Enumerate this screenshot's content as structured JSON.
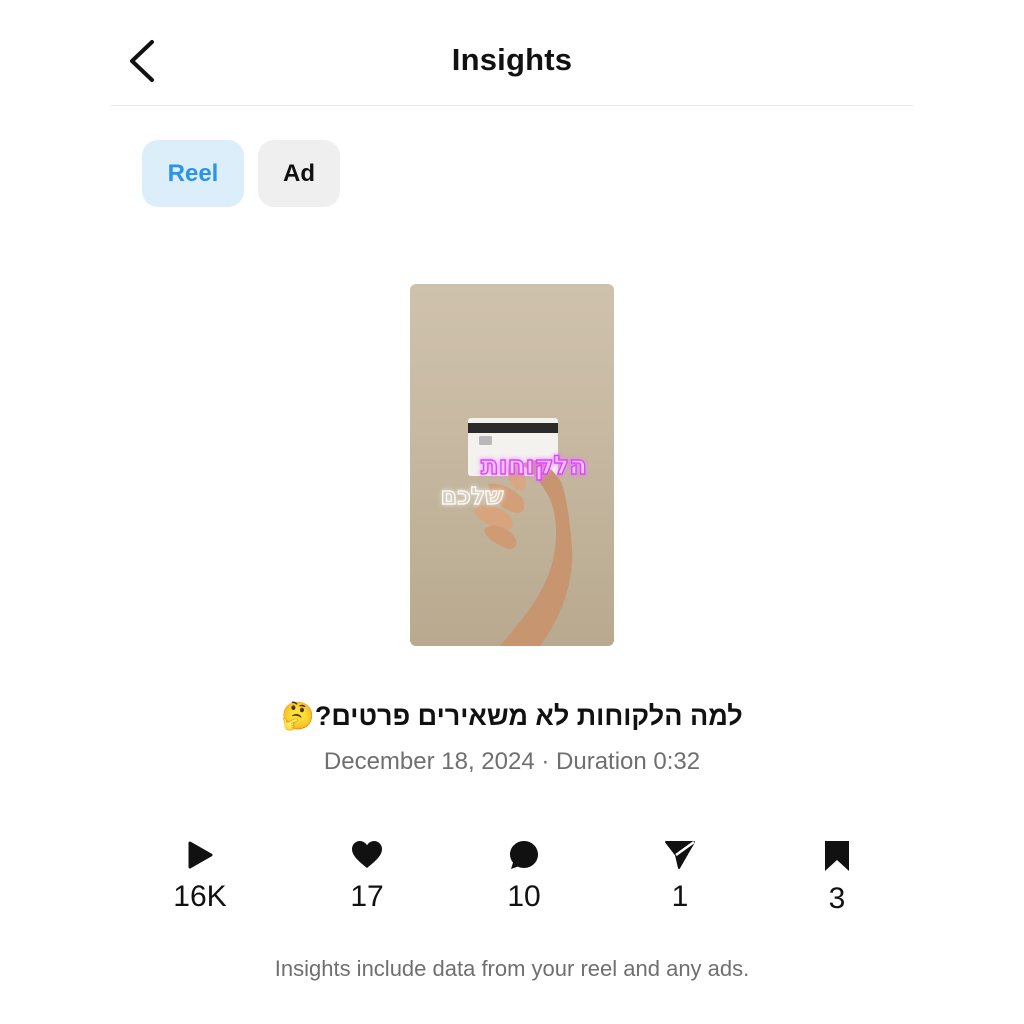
{
  "header": {
    "title": "Insights",
    "back_icon": "chevron-left-icon"
  },
  "tabs": [
    {
      "label": "Reel",
      "selected": true
    },
    {
      "label": "Ad",
      "selected": false
    }
  ],
  "post": {
    "thumbnail_overlay_line1": "הלקוחות",
    "thumbnail_overlay_line2": "שלכם",
    "caption": "למה הלקוחות לא משאירים פרטים?🤔",
    "meta": "December 18, 2024 · Duration 0:32"
  },
  "stats": [
    {
      "icon": "play-icon",
      "value": "16K"
    },
    {
      "icon": "heart-icon",
      "value": "17"
    },
    {
      "icon": "comment-icon",
      "value": "10"
    },
    {
      "icon": "share-icon",
      "value": "1"
    },
    {
      "icon": "bookmark-icon",
      "value": "3"
    }
  ],
  "footnote": "Insights include data from your reel and any ads.",
  "colors": {
    "accent": "#2a94e6",
    "accent_bg": "#ddeefb",
    "neon_pink": "#e040ff"
  }
}
